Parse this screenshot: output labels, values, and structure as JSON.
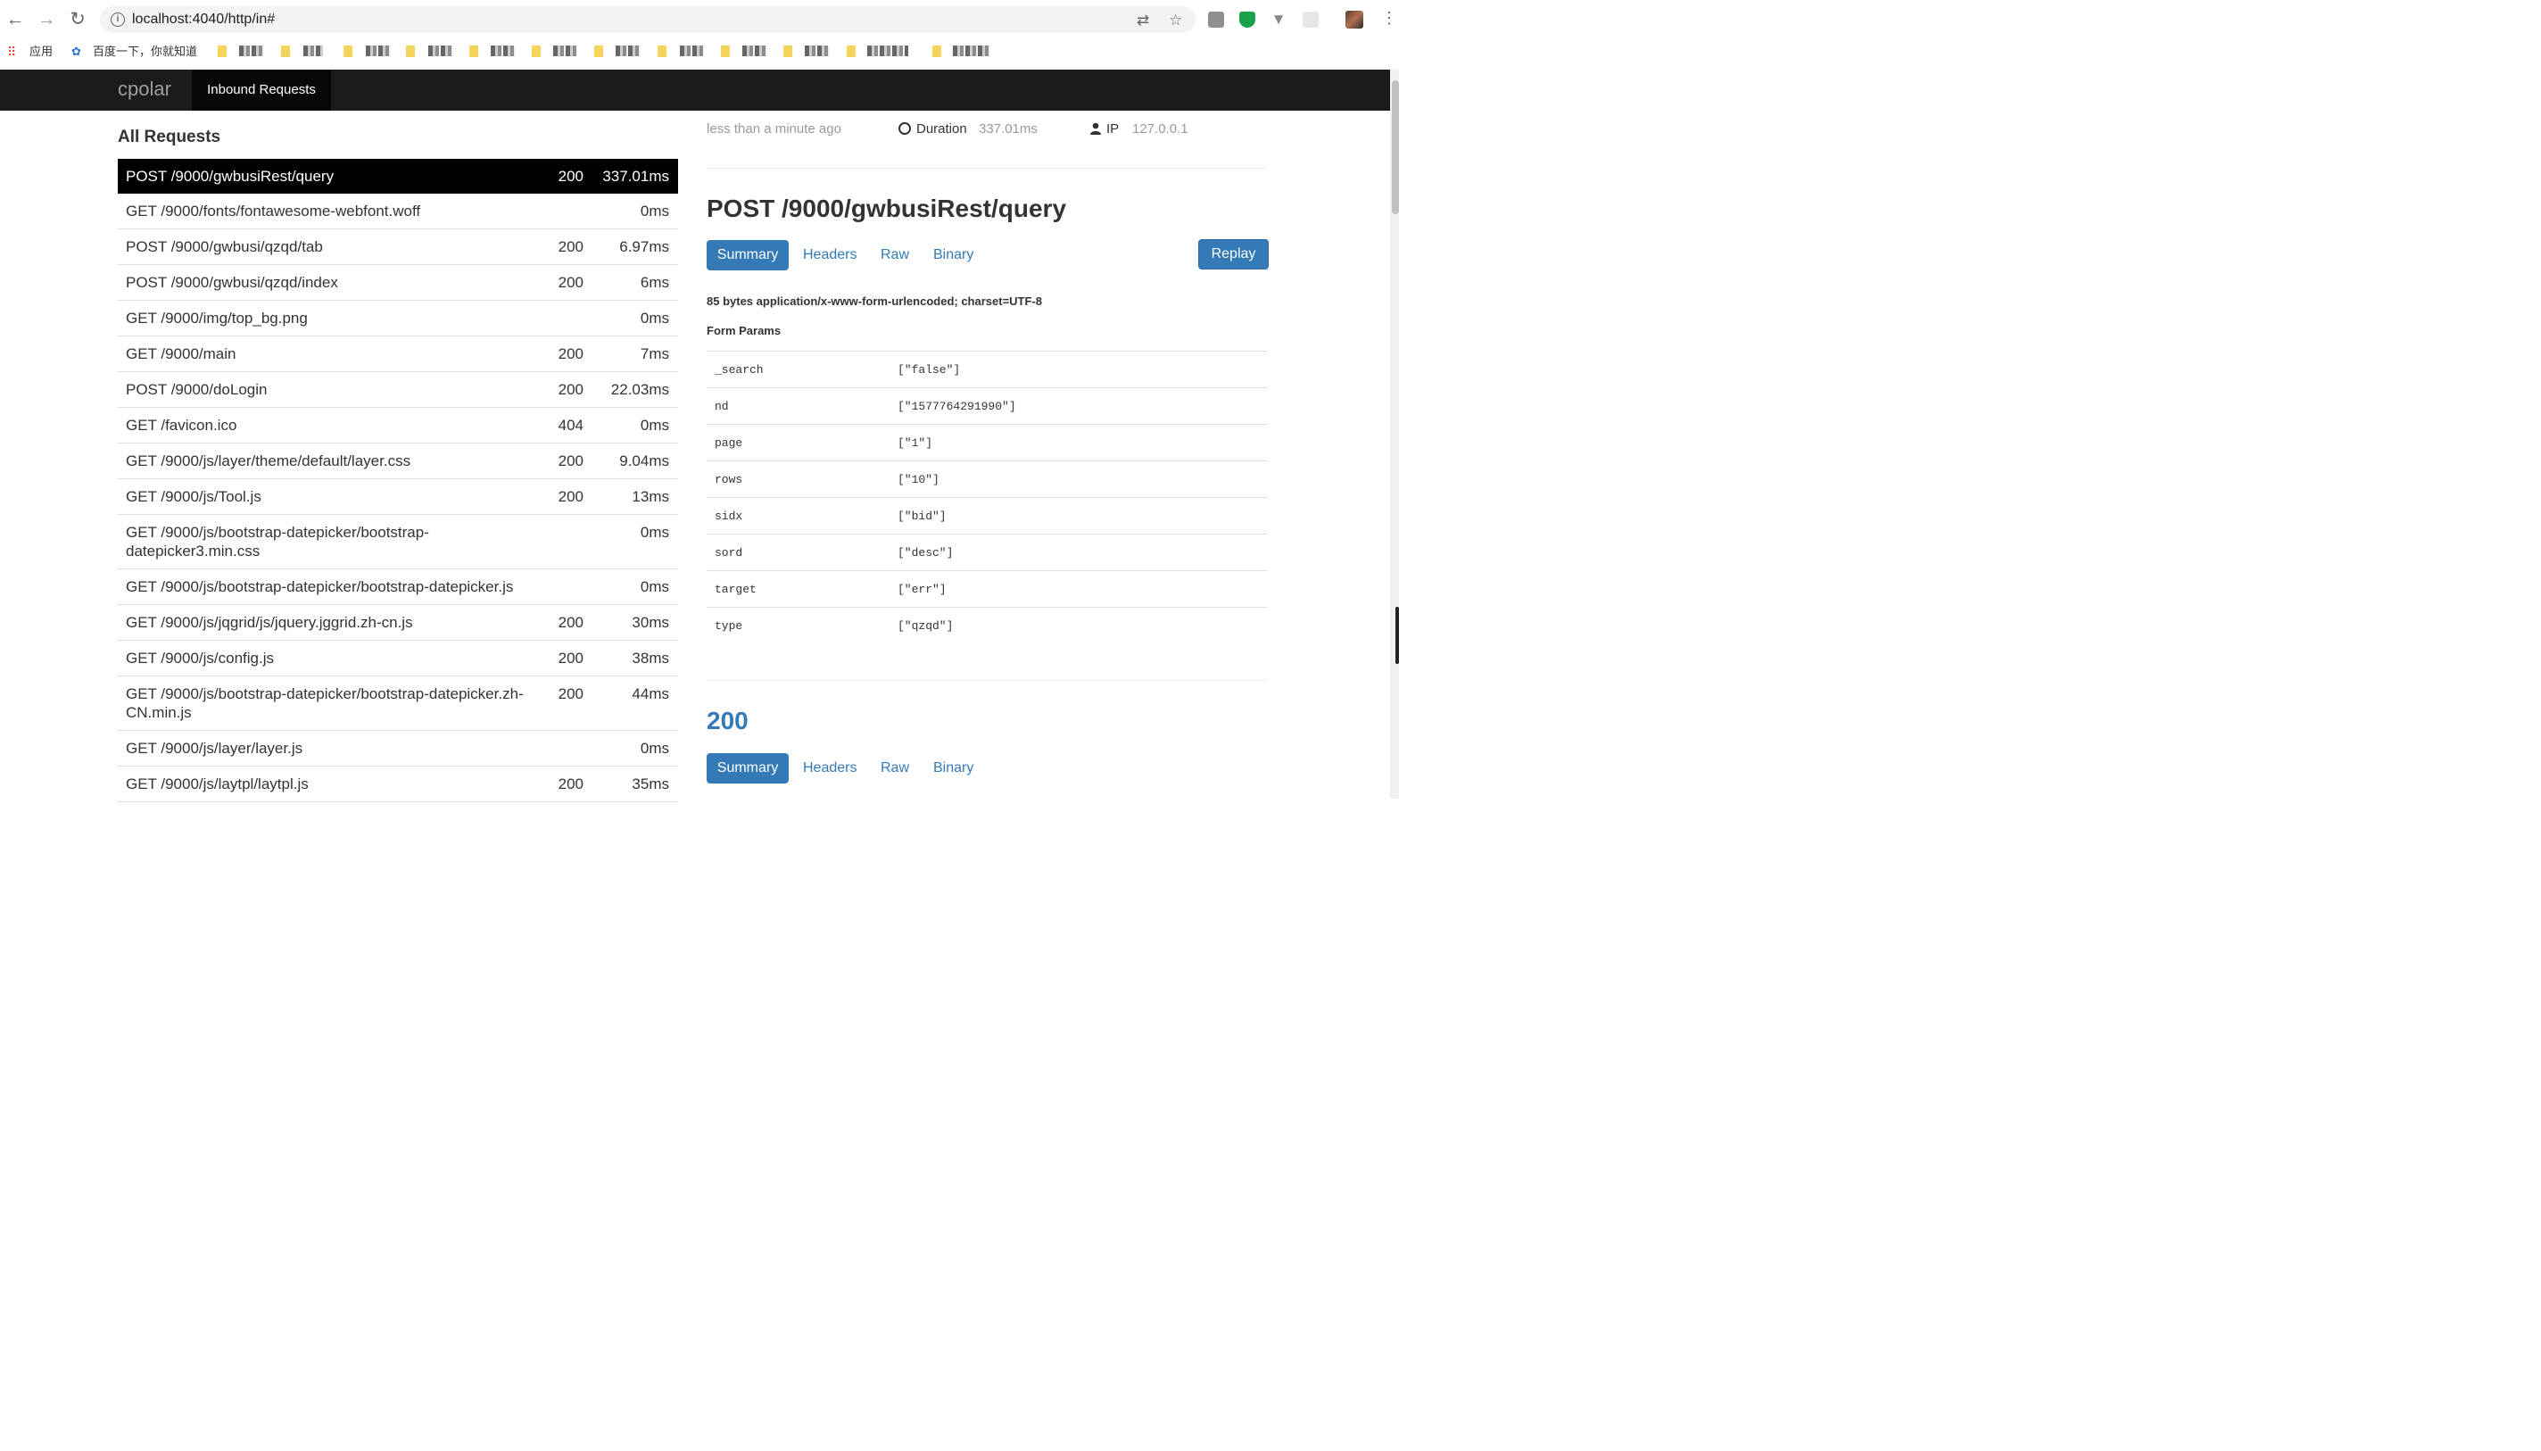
{
  "browser": {
    "url": "localhost:4040/http/in#",
    "bookmarks": {
      "apps_label": "应用",
      "baidu_label": "百度一下，你就知道"
    }
  },
  "app": {
    "brand": "cpolar",
    "nav_tab": "Inbound Requests"
  },
  "list": {
    "title": "All Requests",
    "requests": [
      {
        "path": "POST /9000/gwbusiRest/query",
        "status": "200",
        "duration": "337.01ms",
        "selected": true
      },
      {
        "path": "GET /9000/fonts/fontawesome-webfont.woff",
        "status": "",
        "duration": "0ms"
      },
      {
        "path": "POST /9000/gwbusi/qzqd/tab",
        "status": "200",
        "duration": "6.97ms"
      },
      {
        "path": "POST /9000/gwbusi/qzqd/index",
        "status": "200",
        "duration": "6ms"
      },
      {
        "path": "GET /9000/img/top_bg.png",
        "status": "",
        "duration": "0ms"
      },
      {
        "path": "GET /9000/main",
        "status": "200",
        "duration": "7ms"
      },
      {
        "path": "POST /9000/doLogin",
        "status": "200",
        "duration": "22.03ms"
      },
      {
        "path": "GET /favicon.ico",
        "status": "404",
        "duration": "0ms"
      },
      {
        "path": "GET /9000/js/layer/theme/default/layer.css",
        "status": "200",
        "duration": "9.04ms"
      },
      {
        "path": "GET /9000/js/Tool.js",
        "status": "200",
        "duration": "13ms"
      },
      {
        "path": "GET /9000/js/bootstrap-datepicker/bootstrap-datepicker3.min.css",
        "status": "",
        "duration": "0ms"
      },
      {
        "path": "GET /9000/js/bootstrap-datepicker/bootstrap-datepicker.js",
        "status": "",
        "duration": "0ms"
      },
      {
        "path": "GET /9000/js/jqgrid/js/jquery.jggrid.zh-cn.js",
        "status": "200",
        "duration": "30ms"
      },
      {
        "path": "GET /9000/js/config.js",
        "status": "200",
        "duration": "38ms"
      },
      {
        "path": "GET /9000/js/bootstrap-datepicker/bootstrap-datepicker.zh-CN.min.js",
        "status": "200",
        "duration": "44ms"
      },
      {
        "path": "GET /9000/js/layer/layer.js",
        "status": "",
        "duration": "0ms"
      },
      {
        "path": "GET /9000/js/laytpl/laytpl.js",
        "status": "200",
        "duration": "35ms"
      }
    ]
  },
  "detail": {
    "time_ago": "less than a minute ago",
    "duration_label": "Duration",
    "duration_value": "337.01ms",
    "ip_label": "IP",
    "ip_value": "127.0.0.1",
    "request_title": "POST /9000/gwbusiRest/query",
    "tabs": [
      "Summary",
      "Headers",
      "Raw",
      "Binary"
    ],
    "replay_label": "Replay",
    "body_info": "85 bytes application/x-www-form-urlencoded; charset=UTF-8",
    "form_params_label": "Form Params",
    "params": [
      {
        "key": "_search",
        "value": "[\"false\"]"
      },
      {
        "key": "nd",
        "value": "[\"1577764291990\"]"
      },
      {
        "key": "page",
        "value": "[\"1\"]"
      },
      {
        "key": "rows",
        "value": "[\"10\"]"
      },
      {
        "key": "sidx",
        "value": "[\"bid\"]"
      },
      {
        "key": "sord",
        "value": "[\"desc\"]"
      },
      {
        "key": "target",
        "value": "[\"err\"]"
      },
      {
        "key": "type",
        "value": "[\"qzqd\"]"
      }
    ],
    "response_status": "200",
    "response_tabs": [
      "Summary",
      "Headers",
      "Raw",
      "Binary"
    ]
  },
  "colors": {
    "accent": "#337ab7",
    "navbar": "#1b1b1b",
    "selected_row": "#000000"
  }
}
